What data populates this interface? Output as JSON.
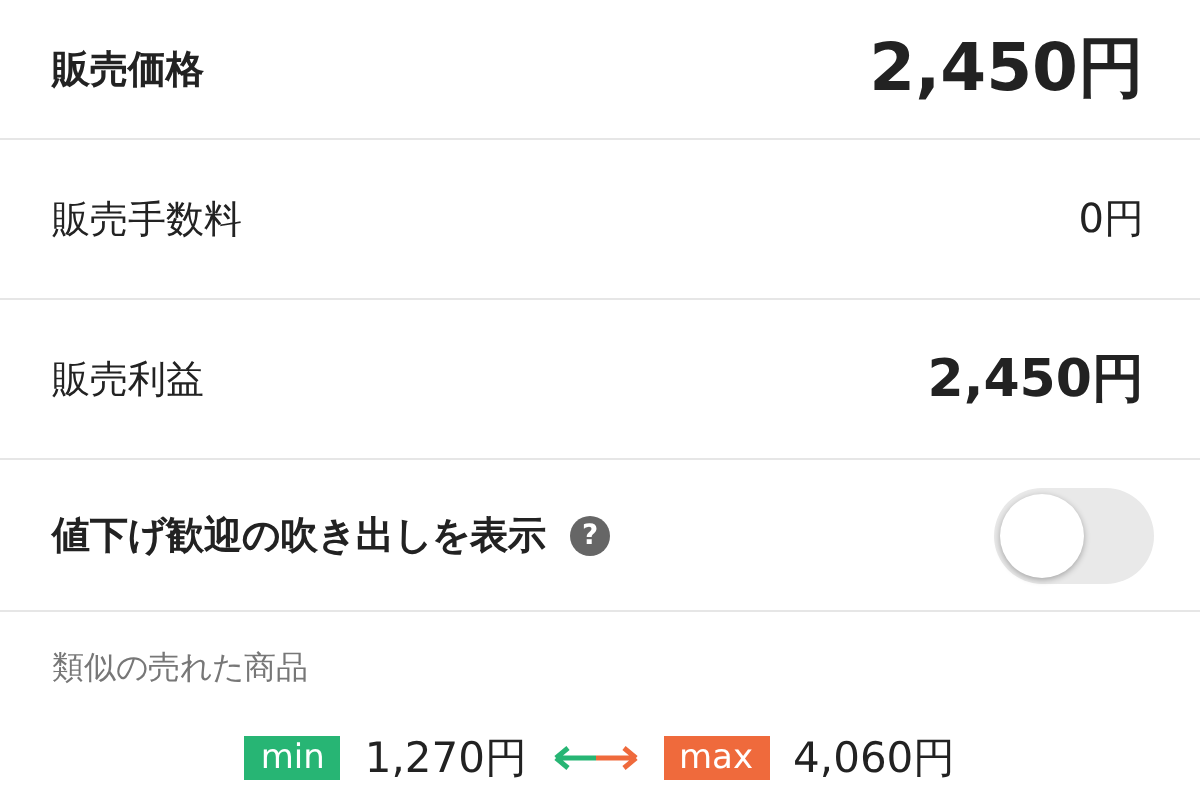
{
  "rows": [
    {
      "label": "販売価格",
      "value": "2,450円",
      "kind": "large"
    },
    {
      "label": "販売手数料",
      "value": "0円",
      "kind": "small"
    },
    {
      "label": "販売利益",
      "value": "2,450円",
      "kind": "medium"
    }
  ],
  "toggle": {
    "label": "値下げ歓迎の吹き出しを表示",
    "help": "?",
    "on": false
  },
  "similar": {
    "title": "類似の売れた商品",
    "min_tag": "min",
    "min_value": "1,270円",
    "max_tag": "max",
    "max_value": "4,060円"
  }
}
